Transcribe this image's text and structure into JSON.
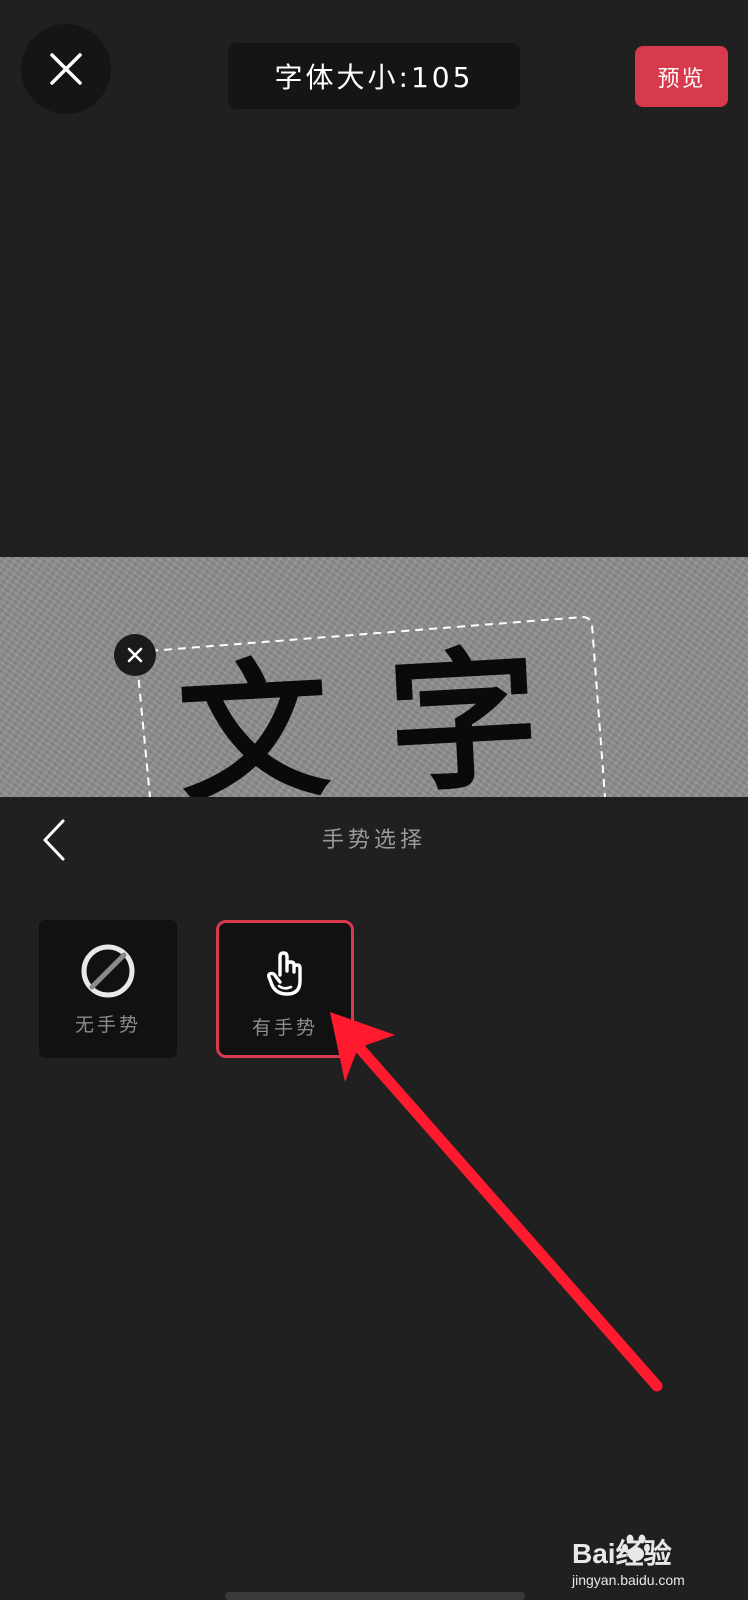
{
  "top_bar": {
    "close_icon": "close-icon",
    "font_size_label": "字体大小:105",
    "preview_label": "预览"
  },
  "canvas": {
    "text": "文字",
    "delete_icon": "close-icon"
  },
  "panel": {
    "back_icon": "chevron-left-icon",
    "title": "手势选择",
    "options": [
      {
        "label": "无手势",
        "icon": "no-gesture-icon",
        "selected": false
      },
      {
        "label": "有手势",
        "icon": "hand-pointer-icon",
        "selected": true
      }
    ]
  },
  "annotation": {
    "arrow_color": "#ff1a2e"
  },
  "watermark": {
    "brand": "Bai经验",
    "url": "jingyan.baidu.com"
  },
  "colors": {
    "accent": "#d63a4c",
    "background": "#202020"
  }
}
